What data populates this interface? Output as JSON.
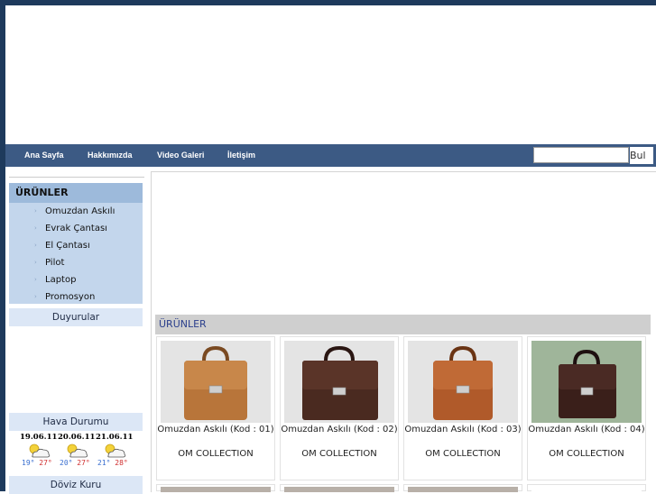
{
  "nav": {
    "items": [
      "Ana Sayfa",
      "Hakkımızda",
      "Video Galeri",
      "İletişim"
    ],
    "search_placeholder": "",
    "search_button": "Bul"
  },
  "sidebar": {
    "products_title": "ÜRÜNLER",
    "products": [
      "Omuzdan Askılı",
      "Evrak Çantası",
      "El Çantası",
      "Pilot",
      "Laptop",
      "Promosyon"
    ],
    "announcements_title": "Duyurular",
    "weather_title": "Hava Durumu",
    "weather": [
      {
        "date": "19.06.11",
        "low": "19°",
        "high": "27°"
      },
      {
        "date": "20.06.11",
        "low": "20°",
        "high": "27°"
      },
      {
        "date": "21.06.11",
        "low": "21°",
        "high": "28°"
      }
    ],
    "currency_title": "Döviz Kuru"
  },
  "main": {
    "products_heading": "ÜRÜNLER",
    "products": [
      {
        "name": "Omuzdan Askılı (Kod : 01)",
        "brand": "OM COLLECTION",
        "color": "#b8753a",
        "bg": "#e4e4e4"
      },
      {
        "name": "Omuzdan Askılı (Kod : 02)",
        "brand": "OM COLLECTION",
        "color": "#4a2a20",
        "bg": "#e4e4e4"
      },
      {
        "name": "Omuzdan Askılı (Kod : 03)",
        "brand": "OM COLLECTION",
        "color": "#b05a2a",
        "bg": "#e4e4e4"
      },
      {
        "name": "Omuzdan Askılı (Kod : 04)",
        "brand": "OM COLLECTION",
        "color": "#3a1f1a",
        "bg": "#9fb59a"
      }
    ]
  }
}
